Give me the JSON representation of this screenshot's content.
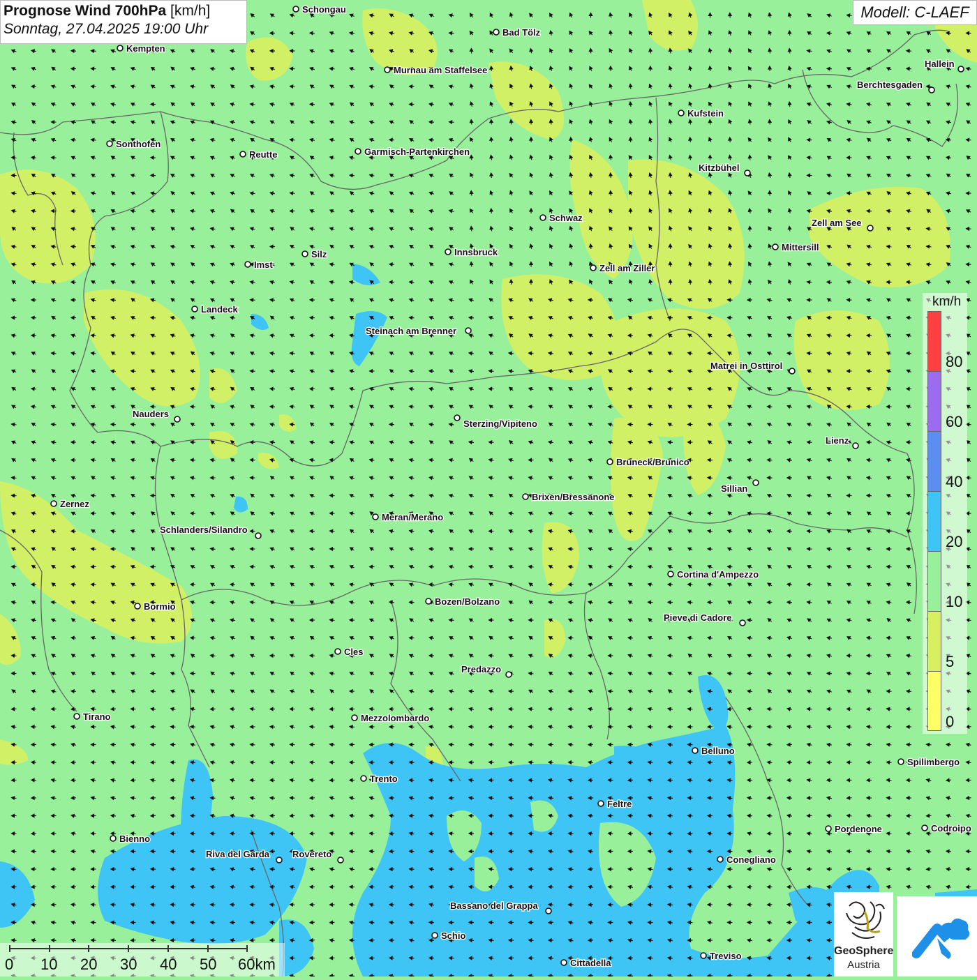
{
  "header": {
    "title_bold": "Prognose Wind 700hPa",
    "title_unit": "[km/h]",
    "datetime": "Sonntag, 27.04.2025 19:00 Uhr",
    "model": "Modell: C-LAEF"
  },
  "legend": {
    "unit": "km/h",
    "colors": [
      "#ff4040",
      "#9b6cf0",
      "#5c8ef0",
      "#3ec4f5",
      "#98f09a",
      "#d8f060",
      "#ffff66"
    ],
    "ticks": [
      "80",
      "60",
      "40",
      "20",
      "10",
      "5",
      "0"
    ]
  },
  "scale_bar": {
    "labels": [
      "0",
      "10",
      "20",
      "30",
      "40",
      "50",
      "60km"
    ]
  },
  "logos": {
    "geosphere_name": "GeoSphere",
    "geosphere_country": "Austria"
  },
  "map_colors": {
    "base": "#98f09a",
    "light_wind": "#d8f060",
    "moderate_wind": "#3ec4f5",
    "border": "#666666",
    "arrow": "#111111"
  },
  "wind_field": {
    "direction": "from east-southeast",
    "predominant_speed_class": "10-20 km/h"
  },
  "cities": [
    {
      "name": "Schongau",
      "dot": [
        424,
        13
      ],
      "label": [
        433,
        13
      ]
    },
    {
      "name": "Bad Tölz",
      "dot": [
        711,
        46
      ],
      "label": [
        720,
        46
      ]
    },
    {
      "name": "Kempten",
      "dot": [
        172,
        69
      ],
      "label": [
        181,
        69
      ]
    },
    {
      "name": "Murnau am Staffelsee",
      "dot": [
        555,
        100
      ],
      "label": [
        564,
        100
      ]
    },
    {
      "name": "Hallein",
      "dot": [
        1377,
        99
      ],
      "label": [
        1325,
        91
      ]
    },
    {
      "name": "Berchtesgaden",
      "dot": [
        1335,
        129
      ],
      "label": [
        1228,
        121
      ]
    },
    {
      "name": "Kufstein",
      "dot": [
        976,
        162
      ],
      "label": [
        985,
        162
      ]
    },
    {
      "name": "Sonthofen",
      "dot": [
        157,
        206
      ],
      "label": [
        166,
        206
      ]
    },
    {
      "name": "Reutte",
      "dot": [
        348,
        221
      ],
      "label": [
        357,
        221
      ]
    },
    {
      "name": "Garmisch-Partenkirchen",
      "dot": [
        513,
        217
      ],
      "label": [
        522,
        217
      ]
    },
    {
      "name": "Kitzbühel",
      "dot": [
        1071,
        248
      ],
      "label": [
        1001,
        240
      ]
    },
    {
      "name": "Schwaz",
      "dot": [
        778,
        312
      ],
      "label": [
        787,
        312
      ]
    },
    {
      "name": "Zell am See",
      "dot": [
        1247,
        327
      ],
      "label": [
        1163,
        319
      ]
    },
    {
      "name": "Mittersill",
      "dot": [
        1111,
        354
      ],
      "label": [
        1120,
        354
      ]
    },
    {
      "name": "Silz",
      "dot": [
        437,
        364
      ],
      "label": [
        446,
        364
      ]
    },
    {
      "name": "Innsbruck",
      "dot": [
        642,
        361
      ],
      "label": [
        651,
        361
      ]
    },
    {
      "name": "Imst",
      "dot": [
        355,
        379
      ],
      "label": [
        364,
        379
      ]
    },
    {
      "name": "Zell am Ziller",
      "dot": [
        850,
        384
      ],
      "label": [
        859,
        384
      ]
    },
    {
      "name": "Landeck",
      "dot": [
        279,
        443
      ],
      "label": [
        288,
        443
      ]
    },
    {
      "name": "Steinach am Brenner",
      "dot": [
        671,
        474
      ],
      "label": [
        524,
        474
      ]
    },
    {
      "name": "Matrei in Osttirol",
      "dot": [
        1135,
        532
      ],
      "label": [
        1018,
        524
      ]
    },
    {
      "name": "Nauders",
      "dot": [
        254,
        601
      ],
      "label": [
        190,
        593
      ]
    },
    {
      "name": "Sterzing/Vipiteno",
      "dot": [
        655,
        599
      ],
      "label": [
        664,
        607
      ]
    },
    {
      "name": "Lienz",
      "dot": [
        1226,
        639
      ],
      "label": [
        1183,
        631
      ]
    },
    {
      "name": "Bruneck/Brunico",
      "dot": [
        874,
        662
      ],
      "label": [
        883,
        662
      ]
    },
    {
      "name": "Sillian",
      "dot": [
        1083,
        692
      ],
      "label": [
        1033,
        700
      ]
    },
    {
      "name": "Brixen/Bressanone",
      "dot": [
        753,
        712
      ],
      "label": [
        762,
        712
      ]
    },
    {
      "name": "Zernez",
      "dot": [
        77,
        722
      ],
      "label": [
        86,
        722
      ]
    },
    {
      "name": "Meran/Merano",
      "dot": [
        538,
        741
      ],
      "label": [
        547,
        741
      ]
    },
    {
      "name": "Schlanders/Silandro",
      "dot": [
        370,
        768
      ],
      "label": [
        229,
        759
      ]
    },
    {
      "name": "Cortina d'Ampezzo",
      "dot": [
        961,
        823
      ],
      "label": [
        970,
        823
      ]
    },
    {
      "name": "Bozen/Bolzano",
      "dot": [
        614,
        862
      ],
      "label": [
        623,
        862
      ]
    },
    {
      "name": "Bormio",
      "dot": [
        197,
        869
      ],
      "label": [
        206,
        869
      ]
    },
    {
      "name": "Pieve di Cadore",
      "dot": [
        1064,
        893
      ],
      "label": [
        951,
        885
      ]
    },
    {
      "name": "Cles",
      "dot": [
        484,
        934
      ],
      "label": [
        493,
        934
      ]
    },
    {
      "name": "Predazzo",
      "dot": [
        729,
        967
      ],
      "label": [
        661,
        959
      ]
    },
    {
      "name": "Tirano",
      "dot": [
        110,
        1027
      ],
      "label": [
        119,
        1027
      ]
    },
    {
      "name": "Mezzolombardo",
      "dot": [
        508,
        1029
      ],
      "label": [
        517,
        1029
      ]
    },
    {
      "name": "Belluno",
      "dot": [
        996,
        1076
      ],
      "label": [
        1005,
        1076
      ]
    },
    {
      "name": "Spilimbergo",
      "dot": [
        1291,
        1092
      ],
      "label": [
        1300,
        1092
      ]
    },
    {
      "name": "Trento",
      "dot": [
        521,
        1116
      ],
      "label": [
        530,
        1116
      ]
    },
    {
      "name": "Feltre",
      "dot": [
        861,
        1152
      ],
      "label": [
        870,
        1152
      ]
    },
    {
      "name": "Pordenone",
      "dot": [
        1187,
        1188
      ],
      "label": [
        1196,
        1188
      ]
    },
    {
      "name": "Codroipo",
      "dot": [
        1325,
        1187
      ],
      "label": [
        1334,
        1187
      ]
    },
    {
      "name": "Bienno",
      "dot": [
        162,
        1202
      ],
      "label": [
        171,
        1202
      ]
    },
    {
      "name": "Riva del Garda",
      "dot": [
        400,
        1233
      ],
      "label": [
        295,
        1224
      ]
    },
    {
      "name": "Rovereto",
      "dot": [
        488,
        1233
      ],
      "label": [
        419,
        1224
      ]
    },
    {
      "name": "Conegliano",
      "dot": [
        1032,
        1232
      ],
      "label": [
        1041,
        1232
      ]
    },
    {
      "name": "Bassano del Grappa",
      "dot": [
        786,
        1306
      ],
      "label": [
        645,
        1298
      ]
    },
    {
      "name": "Schio",
      "dot": [
        623,
        1341
      ],
      "label": [
        632,
        1341
      ]
    },
    {
      "name": "Treviso",
      "dot": [
        1008,
        1370
      ],
      "label": [
        1017,
        1370
      ]
    },
    {
      "name": "Cittadella",
      "dot": [
        808,
        1380
      ],
      "label": [
        817,
        1380
      ]
    }
  ]
}
